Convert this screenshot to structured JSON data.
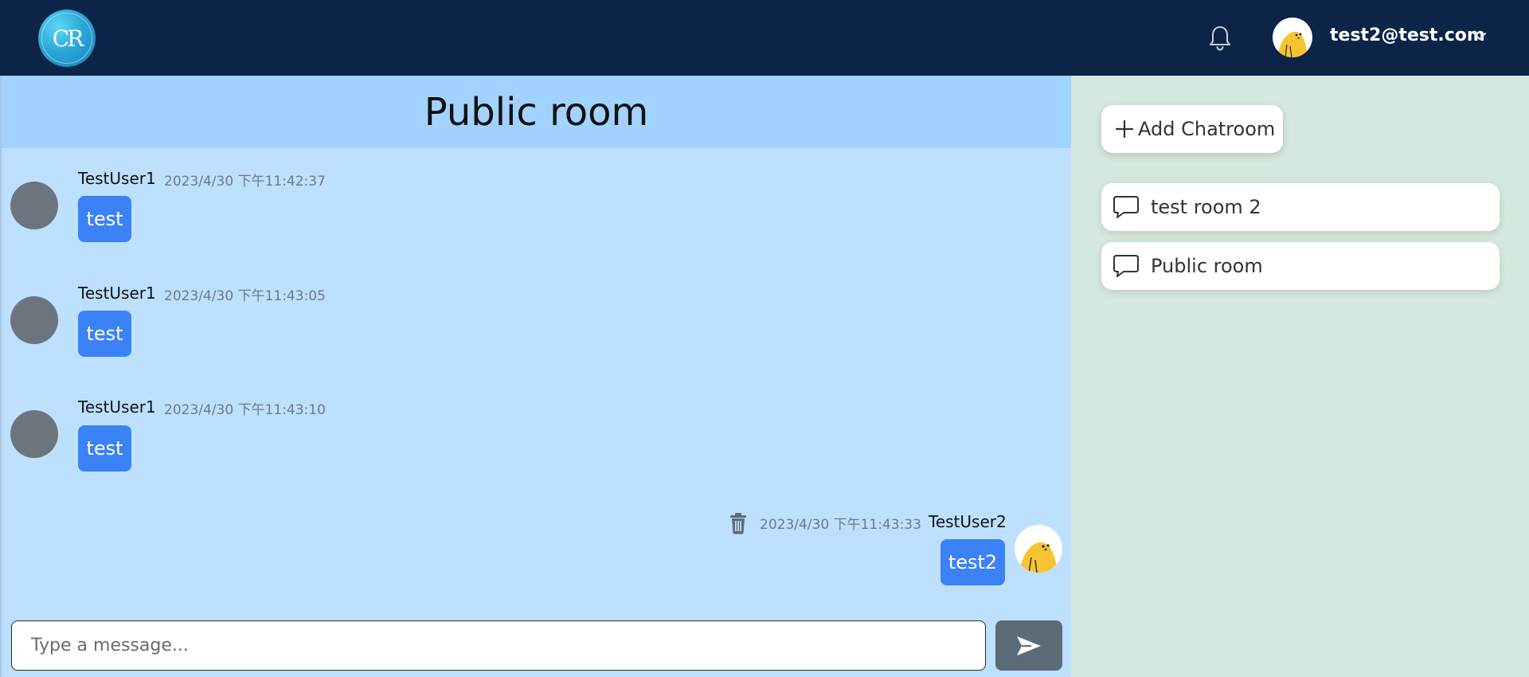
{
  "header": {
    "logo_text": "CR",
    "user_email": "test2@test.com"
  },
  "chat": {
    "title": "Public room",
    "messages": [
      {
        "sender": "TestUser1",
        "timestamp": "2023/4/30 下午11:42:37",
        "text": "test"
      },
      {
        "sender": "TestUser1",
        "timestamp": "2023/4/30 下午11:43:05",
        "text": "test"
      },
      {
        "sender": "TestUser1",
        "timestamp": "2023/4/30 下午11:43:10",
        "text": "test"
      },
      {
        "sender": "TestUser2",
        "timestamp": "2023/4/30 下午11:43:33",
        "text": "test2"
      }
    ],
    "input_placeholder": "Type a message..."
  },
  "sidebar": {
    "add_label": "Add Chatroom",
    "rooms": [
      {
        "label": "test room 2"
      },
      {
        "label": "Public room"
      }
    ]
  },
  "colors": {
    "topbar": "#0b2447",
    "chat_bg": "#bde0fe",
    "chat_header": "#a2d2ff",
    "bubble": "#3b82f6",
    "sidebar_bg": "#d5e8dd",
    "send_button": "#5c6b76"
  },
  "icons": [
    "logo",
    "bell-icon",
    "chevron-down-icon",
    "trash-icon",
    "send-icon",
    "plus-icon",
    "chat-bubble-icon"
  ]
}
